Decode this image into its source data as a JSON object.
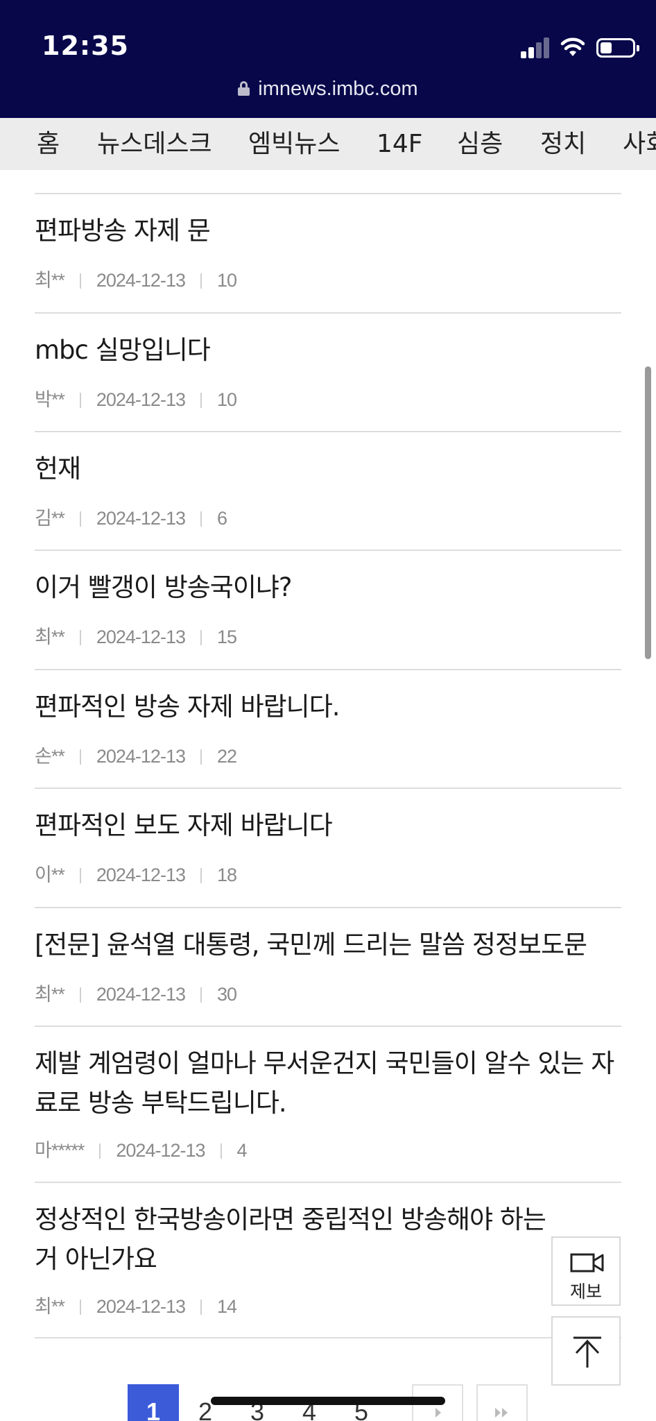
{
  "status_bar": {
    "time": "12:35",
    "url": "imnews.imbc.com",
    "background": "#07074a"
  },
  "nav": {
    "items": [
      {
        "label": "홈"
      },
      {
        "label": "뉴스데스크"
      },
      {
        "label": "엠빅뉴스"
      },
      {
        "label": "14F"
      },
      {
        "label": "심층"
      },
      {
        "label": "정치"
      },
      {
        "label": "사회"
      }
    ]
  },
  "posts": [
    {
      "title": "편파방송 자제 문",
      "author": "최**",
      "date": "2024-12-13",
      "views": "10"
    },
    {
      "title": "mbc 실망입니다",
      "author": "박**",
      "date": "2024-12-13",
      "views": "10"
    },
    {
      "title": "헌재",
      "author": "김**",
      "date": "2024-12-13",
      "views": "6"
    },
    {
      "title": "이거 빨갱이 방송국이냐?",
      "author": "최**",
      "date": "2024-12-13",
      "views": "15"
    },
    {
      "title": "편파적인 방송 자제 바랍니다.",
      "author": "손**",
      "date": "2024-12-13",
      "views": "22"
    },
    {
      "title": "편파적인 보도 자제 바랍니다",
      "author": "이**",
      "date": "2024-12-13",
      "views": "18"
    },
    {
      "title": "[전문] 윤석열 대통령, 국민께 드리는 말씀 정정보도문",
      "author": "최**",
      "date": "2024-12-13",
      "views": "30"
    },
    {
      "title": "제발 계엄령이 얼마나 무서운건지 국민들이 알수 있는 자료로 방송 부탁드립니다.",
      "author": "마*****",
      "date": "2024-12-13",
      "views": "4"
    },
    {
      "title": "정상적인 한국방송이라면 중립적인 방송해야 하는거 아닌가요",
      "author": "최**",
      "date": "2024-12-13",
      "views": "14"
    }
  ],
  "floating": {
    "report_label": "제보"
  },
  "pagination": {
    "pages": [
      "1",
      "2",
      "3",
      "4",
      "5"
    ],
    "current": "1",
    "active_color": "#3b5bd9"
  }
}
